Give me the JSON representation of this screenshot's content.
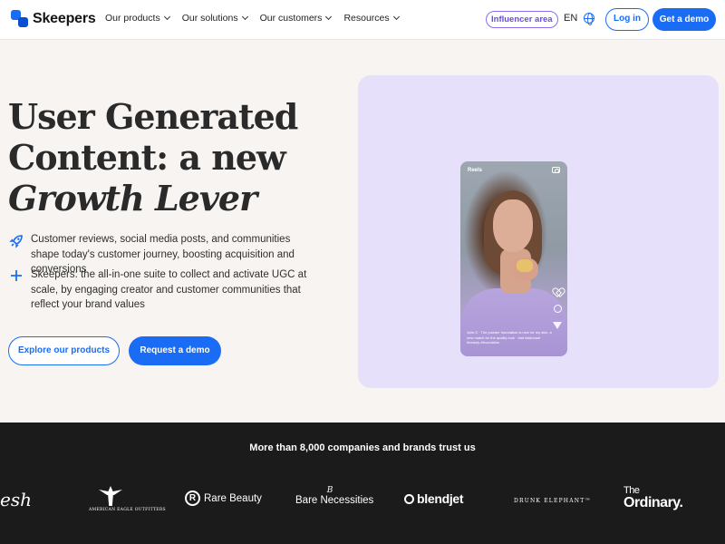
{
  "nav": {
    "brand": "Skeepers",
    "menu": [
      {
        "label": "Our products"
      },
      {
        "label": "Our solutions"
      },
      {
        "label": "Our customers"
      },
      {
        "label": "Resources"
      }
    ],
    "influencer_label": "Influencer area",
    "lang": "EN",
    "login_label": "Log in",
    "demo_label": "Get a demo"
  },
  "hero": {
    "title_line1": "User Generated",
    "title_line2": "Content: a new",
    "title_line3": "Growth Lever",
    "bullet1": "Customer reviews, social media posts, and communities shape today's customer journey, boosting acquisition and conversions",
    "bullet2": "Skeepers: the all-in-one suite to collect and activate UGC at scale, by engaging creator and customer communities that reflect your brand values",
    "explore_label": "Explore our products",
    "request_label": "Request a demo"
  },
  "phone": {
    "label": "Reels",
    "caption": "Julie.S · The powder foundation is nice for my skin, a new match for the quality look · #ad #skincare #beauty #foundation"
  },
  "trust": {
    "title": "More than 8,000 companies and brands trust us",
    "logos": {
      "fresh": "esh",
      "ae": "AMERICAN EAGLE OUTFITTERS",
      "rare_mark": "R",
      "rare": "Rare Beauty",
      "bare_mark": "B",
      "bare": "Bare Necessities",
      "blendjet": "blendjet",
      "drunk": "DRUNK ELEPHANT™",
      "ordinary_top": "The",
      "ordinary": "Ordinary."
    }
  },
  "colors": {
    "accent": "#1a6cf5",
    "influencer": "#6a49e8",
    "panel": "#e7e0fb",
    "band": "#1c1b1b",
    "page": "#f7f4f1"
  }
}
